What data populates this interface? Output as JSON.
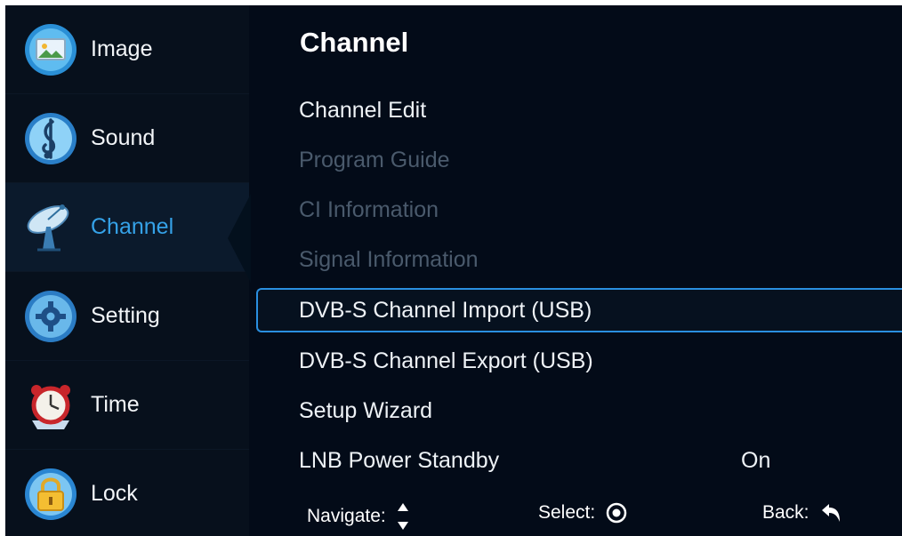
{
  "sidebar": {
    "items": [
      {
        "label": "Image",
        "icon": "image-icon",
        "active": false
      },
      {
        "label": "Sound",
        "icon": "music-note-icon",
        "active": false
      },
      {
        "label": "Channel",
        "icon": "satellite-dish-icon",
        "active": true
      },
      {
        "label": "Setting",
        "icon": "gear-icon",
        "active": false
      },
      {
        "label": "Time",
        "icon": "alarm-clock-icon",
        "active": false
      },
      {
        "label": "Lock",
        "icon": "padlock-icon",
        "active": false
      }
    ]
  },
  "panel": {
    "title": "Channel",
    "items": [
      {
        "label": "Channel Edit",
        "state": "enabled"
      },
      {
        "label": "Program Guide",
        "state": "disabled"
      },
      {
        "label": "CI Information",
        "state": "disabled"
      },
      {
        "label": "Signal Information",
        "state": "disabled"
      },
      {
        "label": "DVB-S Channel Import (USB)",
        "state": "selected"
      },
      {
        "label": "DVB-S Channel Export (USB)",
        "state": "enabled"
      },
      {
        "label": "Setup Wizard",
        "state": "enabled"
      },
      {
        "label": "LNB Power Standby",
        "state": "enabled",
        "value": "On"
      }
    ]
  },
  "footer": {
    "navigate": "Navigate:",
    "select": "Select:",
    "back": "Back:"
  },
  "colors": {
    "background": "#030b18",
    "accent": "#35a2e8",
    "selection_border": "#2a8fe0",
    "disabled_text": "#4a5a6c"
  }
}
